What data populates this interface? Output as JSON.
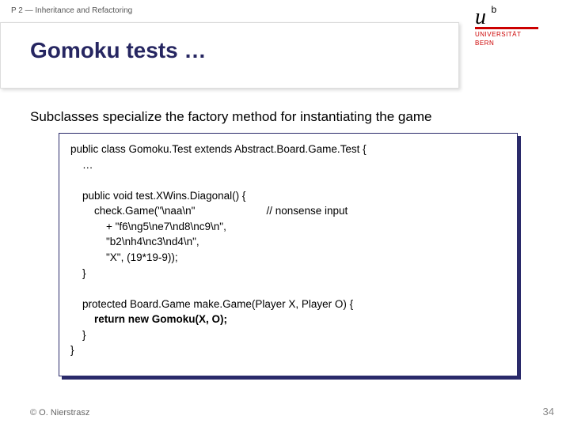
{
  "header": {
    "course_label": "P 2 — Inheritance and Refactoring",
    "title": "Gomoku tests …",
    "logo": {
      "u": "u",
      "b": "b",
      "uni_line1": "UNIVERSITÄT",
      "uni_line2": "BERN"
    }
  },
  "subtitle": "Subclasses specialize the factory method for instantiating the game",
  "code": {
    "l1": "public class Gomoku.Test extends Abstract.Board.Game.Test {",
    "l2": "    …",
    "l3": "",
    "l4": "    public void test.XWins.Diagonal() {",
    "l5a": "        check.Game(\"\\naa\\n\"",
    "l5b": "// nonsense input",
    "l6": "            + \"f6\\ng5\\ne7\\nd8\\nc9\\n\",",
    "l7": "            \"b2\\nh4\\nc3\\nd4\\n\",",
    "l8": "            \"X\", (19*19-9));",
    "l9": "    }",
    "l10": "",
    "l11": "    protected Board.Game make.Game(Player X, Player O) {",
    "l12": "        return new Gomoku(X, O);",
    "l13": "    }",
    "l14": "}"
  },
  "footer": {
    "copyright": "© O. Nierstrasz",
    "page": "34"
  }
}
